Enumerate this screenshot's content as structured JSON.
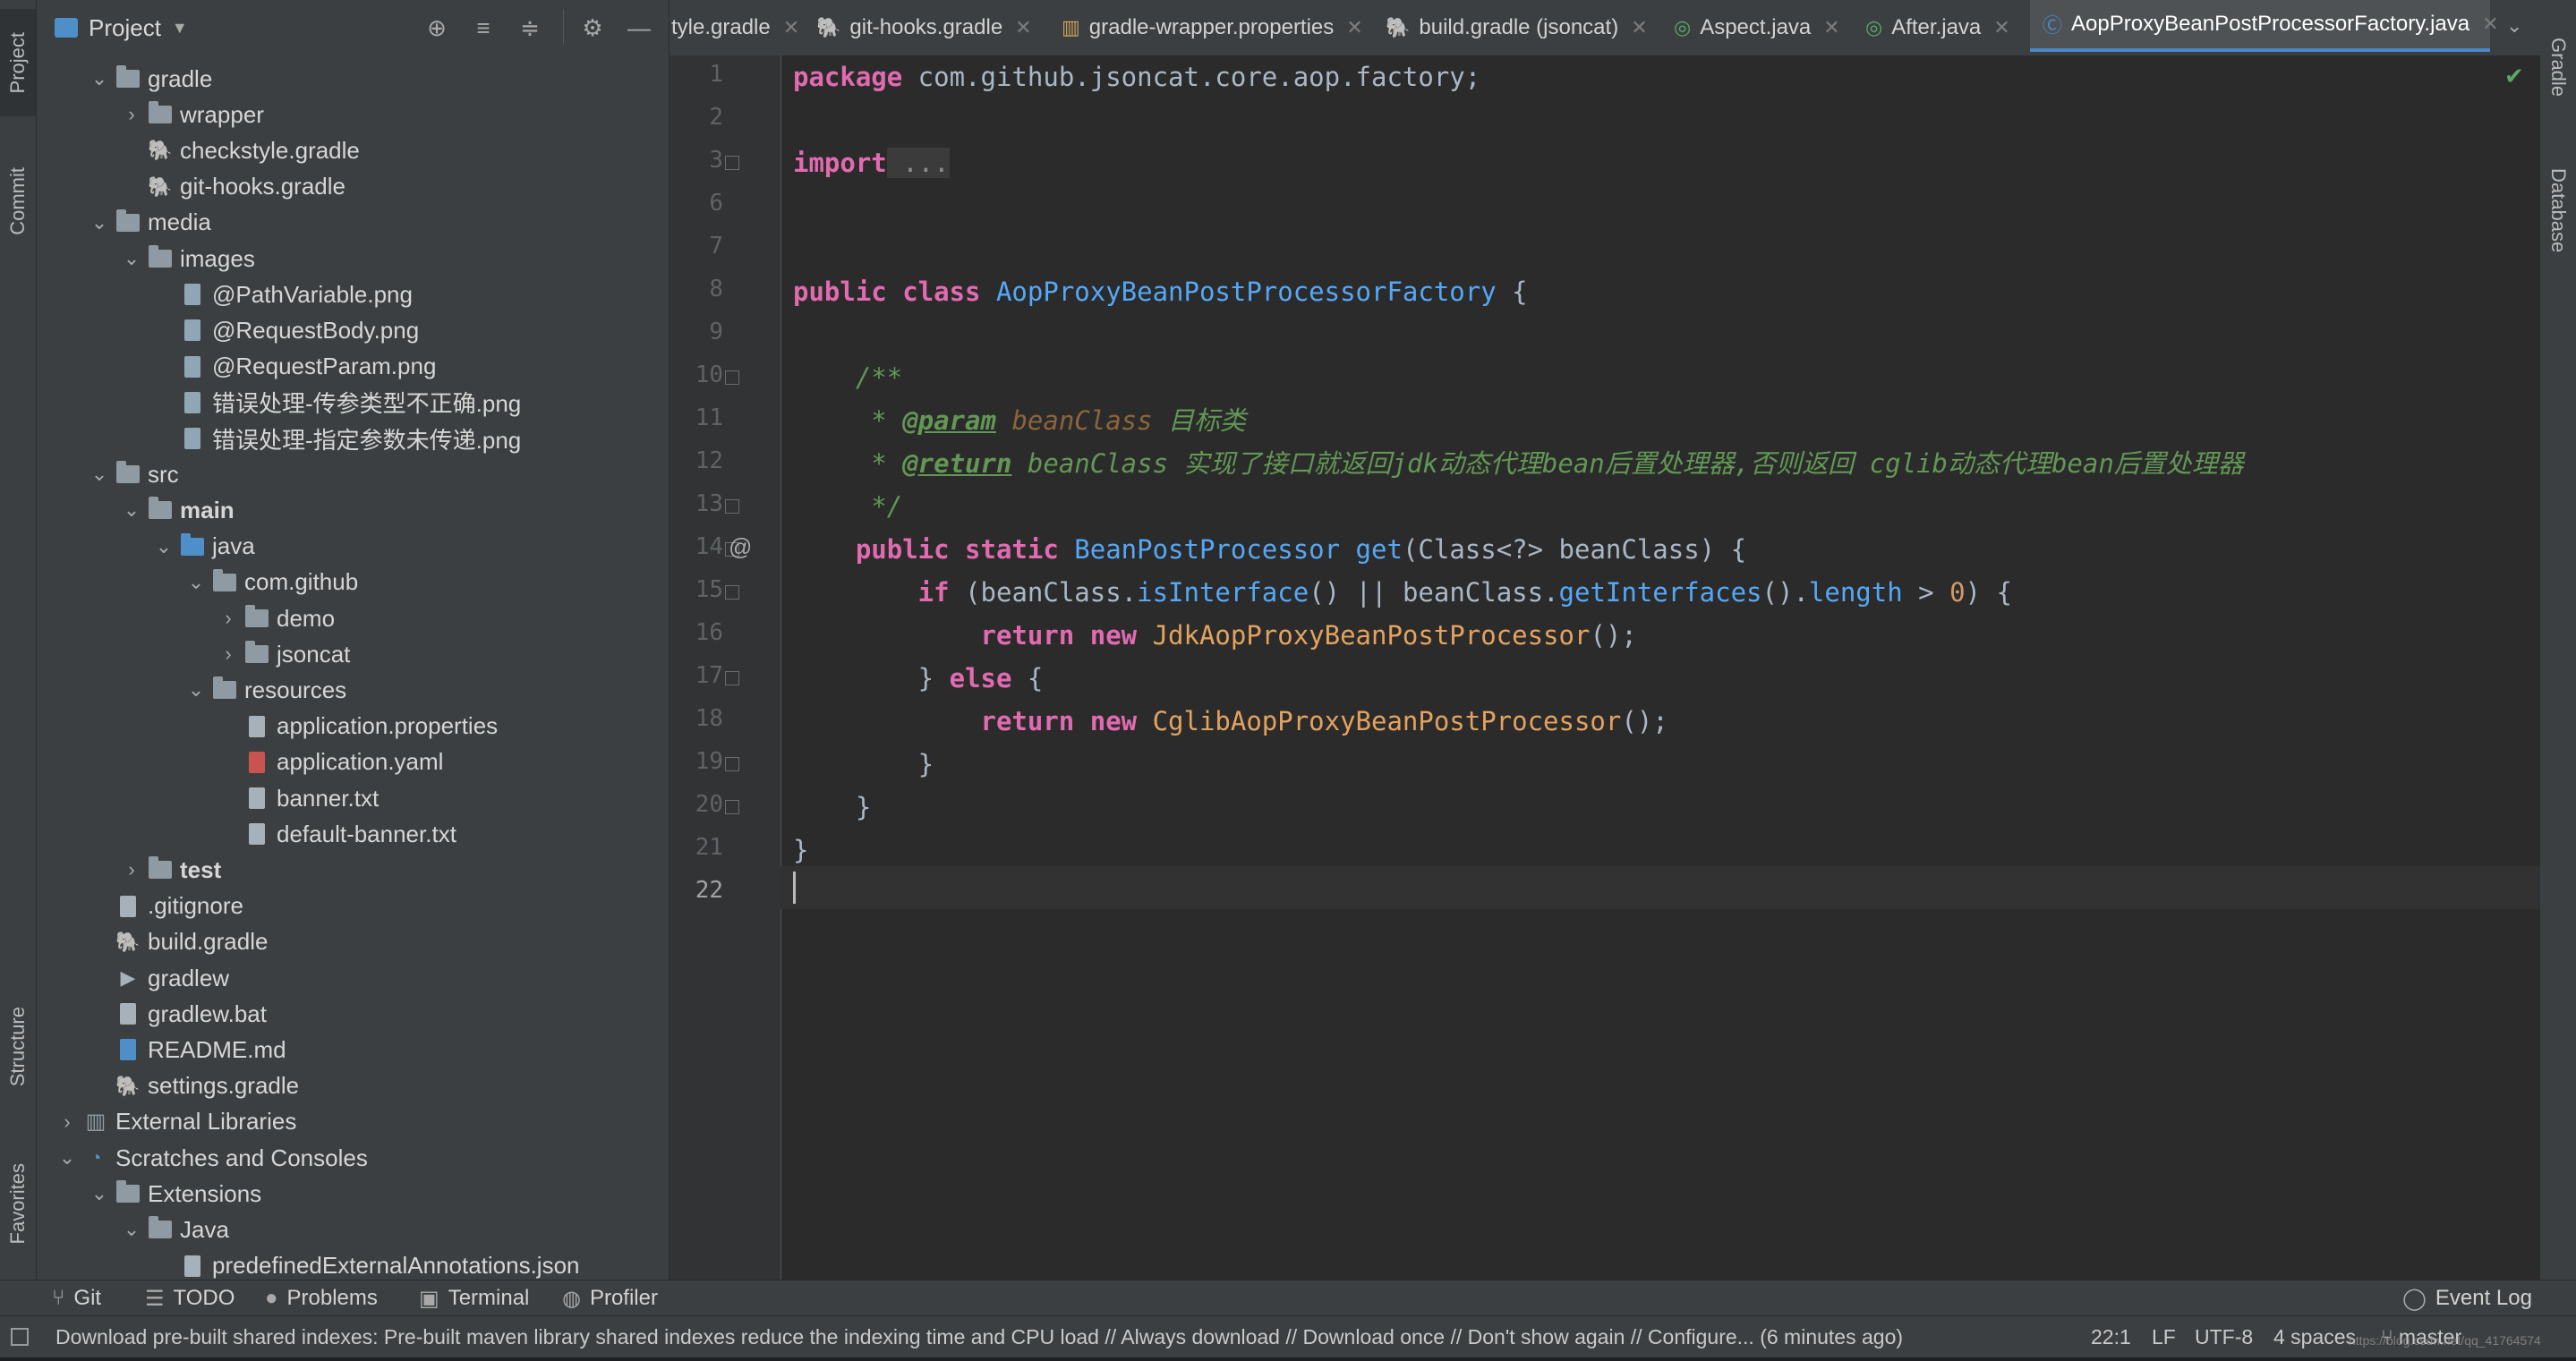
{
  "left_strip": {
    "tabs": [
      {
        "label": "Project",
        "icon": "folder-icon"
      },
      {
        "label": "Commit",
        "icon": "commit-icon"
      },
      {
        "label": "Structure",
        "icon": "structure-icon"
      },
      {
        "label": "Favorites",
        "icon": "star-icon"
      }
    ]
  },
  "right_strip": {
    "tabs": [
      {
        "label": "Gradle",
        "icon": "gradle-icon"
      },
      {
        "label": "Database",
        "icon": "database-icon"
      }
    ]
  },
  "project_panel": {
    "title": "Project",
    "tree": [
      {
        "label": "gradle",
        "icon": "folder",
        "expanded": true
      },
      {
        "label": "wrapper",
        "icon": "folder",
        "expanded": false
      },
      {
        "label": "checkstyle.gradle",
        "icon": "gradle-file"
      },
      {
        "label": "git-hooks.gradle",
        "icon": "gradle-file"
      },
      {
        "label": "media",
        "icon": "folder",
        "expanded": true
      },
      {
        "label": "images",
        "icon": "folder",
        "expanded": true
      },
      {
        "label": "@PathVariable.png",
        "icon": "image-file"
      },
      {
        "label": "@RequestBody.png",
        "icon": "image-file"
      },
      {
        "label": "@RequestParam.png",
        "icon": "image-file"
      },
      {
        "label": "错误处理-传参类型不正确.png",
        "icon": "image-file"
      },
      {
        "label": "错误处理-指定参数未传递.png",
        "icon": "image-file"
      },
      {
        "label": "src",
        "icon": "folder",
        "expanded": true
      },
      {
        "label": "main",
        "icon": "folder",
        "expanded": true,
        "bold": true
      },
      {
        "label": "java",
        "icon": "source-folder",
        "expanded": true
      },
      {
        "label": "com.github",
        "icon": "package-folder",
        "expanded": true
      },
      {
        "label": "demo",
        "icon": "package-folder",
        "expanded": false
      },
      {
        "label": "jsoncat",
        "icon": "package-folder",
        "expanded": false
      },
      {
        "label": "resources",
        "icon": "resources-folder",
        "expanded": true
      },
      {
        "label": "application.properties",
        "icon": "properties-file"
      },
      {
        "label": "application.yaml",
        "icon": "yaml-file"
      },
      {
        "label": "banner.txt",
        "icon": "text-file"
      },
      {
        "label": "default-banner.txt",
        "icon": "text-file"
      },
      {
        "label": "test",
        "icon": "folder",
        "expanded": false,
        "bold": true
      },
      {
        "label": ".gitignore",
        "icon": "gitignore-file"
      },
      {
        "label": "build.gradle",
        "icon": "gradle-file"
      },
      {
        "label": "gradlew",
        "icon": "script-file"
      },
      {
        "label": "gradlew.bat",
        "icon": "text-file"
      },
      {
        "label": "README.md",
        "icon": "markdown-file"
      },
      {
        "label": "settings.gradle",
        "icon": "gradle-file"
      },
      {
        "label": "External Libraries",
        "icon": "library-icon",
        "expanded": false
      },
      {
        "label": "Scratches and Consoles",
        "icon": "scratches-icon",
        "expanded": true
      },
      {
        "label": "Extensions",
        "icon": "folder",
        "expanded": true
      },
      {
        "label": "Java",
        "icon": "folder",
        "expanded": true
      },
      {
        "label": "predefinedExternalAnnotations.json",
        "icon": "json-file"
      }
    ]
  },
  "tabs": [
    {
      "label": "tyle.gradle",
      "icon": "gradle-file"
    },
    {
      "label": "git-hooks.gradle",
      "icon": "gradle-file"
    },
    {
      "label": "gradle-wrapper.properties",
      "icon": "properties-file"
    },
    {
      "label": "build.gradle (jsoncat)",
      "icon": "gradle-file"
    },
    {
      "label": "Aspect.java",
      "icon": "annotation-icon"
    },
    {
      "label": "After.java",
      "icon": "annotation-icon"
    },
    {
      "label": "AopProxyBeanPostProcessorFactory.java",
      "icon": "class-icon",
      "active": true
    }
  ],
  "editor": {
    "line_numbers": [
      "1",
      "2",
      "3",
      "6",
      "7",
      "8",
      "9",
      "10",
      "11",
      "12",
      "13",
      "14",
      "15",
      "16",
      "17",
      "18",
      "19",
      "20",
      "21",
      "22"
    ],
    "current_line": "22",
    "code": {
      "l1_kw": "package",
      "l1_pkg": " com.github.jsoncat.core.aop.factory;",
      "l3_kw": "import",
      "l3_folded": " ...",
      "l8_kw": "public class",
      "l8_name": " AopProxyBeanPostProcessorFactory",
      "l8_rest": " {",
      "l10": "    /**",
      "l11_star": "     * ",
      "l11_tag": "@param",
      "l11_param": " beanClass",
      "l11_text": " 目标类",
      "l12_star": "     * ",
      "l12_tag": "@return",
      "l12_param": " beanClass",
      "l12_text": " 实现了接口就返回jdk动态代理bean后置处理器,否则返回 cglib动态代理bean后置处理器",
      "l13": "     */",
      "l14_kw": "    public static",
      "l14_type": " BeanPostProcessor",
      "l14_m": " get",
      "l14_rest": "(Class<?> beanClass) {",
      "l15_kw": "        if",
      "l15_a": " (beanClass.",
      "l15_m1": "isInterface",
      "l15_b": "() || beanClass.",
      "l15_m2": "getInterfaces",
      "l15_c": "().",
      "l15_f": "length",
      "l15_d": " > ",
      "l15_n": "0",
      "l15_e": ") {",
      "l16_kw": "            return new",
      "l16_cls": " JdkAopProxyBeanPostProcessor",
      "l16_rest": "();",
      "l17_a": "        } ",
      "l17_kw": "else",
      "l17_b": " {",
      "l18_kw": "            return new",
      "l18_cls": " CglibAopProxyBeanPostProcessor",
      "l18_rest": "();",
      "l19": "        }",
      "l20": "    }",
      "l21": "}"
    },
    "override_marker": "@"
  },
  "tool_windows": [
    {
      "label": "Git",
      "icon": "git-branch-icon"
    },
    {
      "label": "TODO",
      "icon": "list-icon"
    },
    {
      "label": "Problems",
      "icon": "info-icon"
    },
    {
      "label": "Terminal",
      "icon": "terminal-icon"
    },
    {
      "label": "Profiler",
      "icon": "profiler-icon"
    },
    {
      "label": "Event Log",
      "icon": "event-log-icon"
    }
  ],
  "status": {
    "message": "Download pre-built shared indexes: Pre-built maven library shared indexes reduce the indexing time and CPU load // Always download // Download once // Don't show again // Configure... (6 minutes ago)",
    "position": "22:1",
    "line_sep": "LF",
    "encoding": "UTF-8",
    "indent": "4 spaces",
    "branch": "master",
    "watermark": "https://blog.csdn.net/qq_41764574"
  },
  "colors": {
    "accent": "#4a88c7",
    "editor_bg": "#2b2b2b",
    "panel_bg": "#3c3f41",
    "keyword": "#cc7832",
    "doc_comment": "#629755",
    "ok_check": "#59a869"
  }
}
